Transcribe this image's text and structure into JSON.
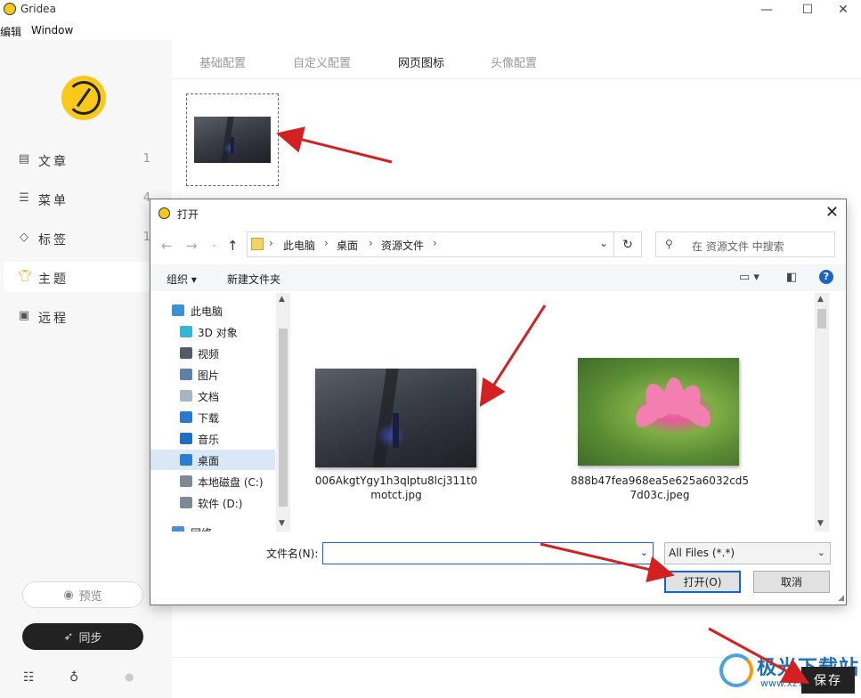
{
  "window": {
    "title": "Gridea",
    "minimize": "—",
    "maximize": "☐",
    "close": "✕"
  },
  "menubar": {
    "edit": "编辑",
    "window": "Window"
  },
  "sidebar": {
    "items": [
      {
        "label": "文章",
        "count": "1"
      },
      {
        "label": "菜单",
        "count": "4"
      },
      {
        "label": "标签",
        "count": "1"
      },
      {
        "label": "主题",
        "count": ""
      },
      {
        "label": "远程",
        "count": ""
      }
    ],
    "preview_label": "预览",
    "sync_label": "同步"
  },
  "tabs": [
    {
      "label": "基础配置"
    },
    {
      "label": "自定义配置"
    },
    {
      "label": "网页图标"
    },
    {
      "label": "头像配置"
    }
  ],
  "save_label": "保存",
  "watermark": {
    "text": "极光下载站",
    "url": "www.xz7.com"
  },
  "dialog": {
    "title": "打开",
    "breadcrumb": [
      "此电脑",
      "桌面",
      "资源文件"
    ],
    "search_placeholder": "在 资源文件 中搜索",
    "organize_label": "组织 ▾",
    "new_folder_label": "新建文件夹",
    "help": "?",
    "tree": [
      {
        "label": "此电脑",
        "color": "#3d8fd8"
      },
      {
        "label": "3D 对象",
        "color": "#36b5d6"
      },
      {
        "label": "视频",
        "color": "#555b66"
      },
      {
        "label": "图片",
        "color": "#5e7fa8"
      },
      {
        "label": "文档",
        "color": "#a8b4c0"
      },
      {
        "label": "下载",
        "color": "#2a78d0"
      },
      {
        "label": "音乐",
        "color": "#1e6fc4"
      },
      {
        "label": "桌面",
        "color": "#2b7ed1"
      },
      {
        "label": "本地磁盘 (C:)",
        "color": "#7d8a96"
      },
      {
        "label": "软件 (D:)",
        "color": "#7d8a96"
      },
      {
        "label": "网络",
        "color": "#4a8fd6"
      }
    ],
    "files": [
      {
        "name": "006AkgtYgy1h3qlptu8lcj311t0motct.jpg"
      },
      {
        "name": "888b47fea968ea5e625a6032cd57d03c.jpeg"
      }
    ],
    "filename_label": "文件名(N):",
    "filename_value": "",
    "filetype_value": "All Files (*.*)",
    "open_label": "打开(O)",
    "cancel_label": "取消"
  }
}
